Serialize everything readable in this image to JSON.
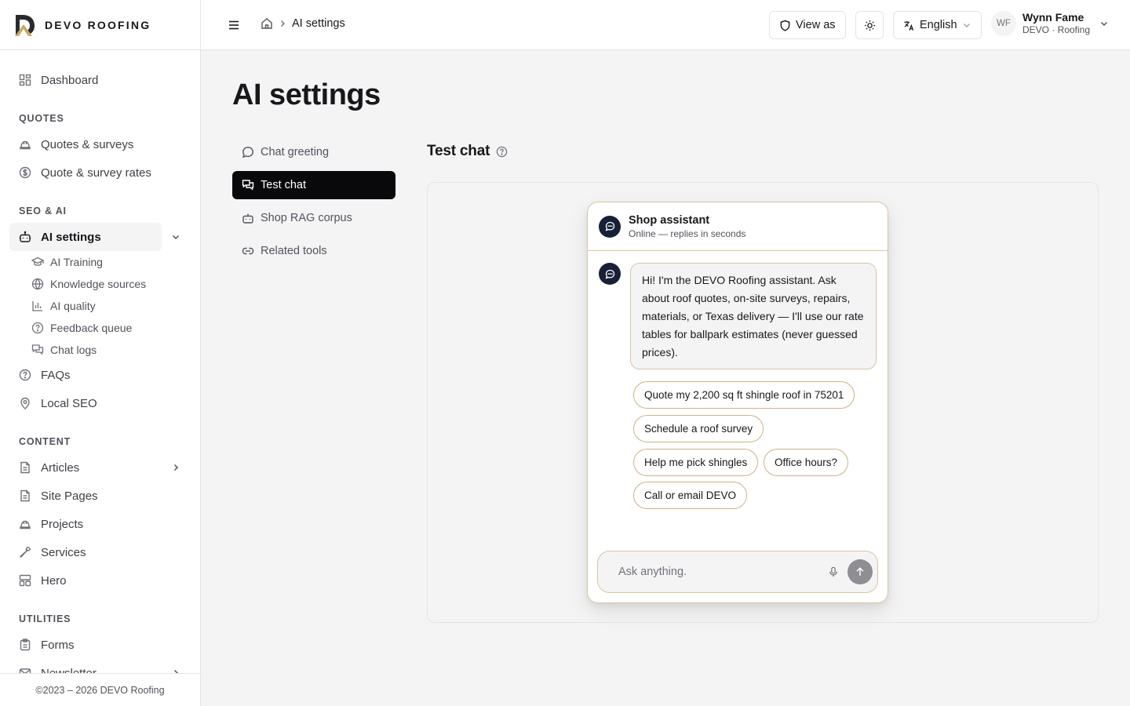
{
  "brand": {
    "name": "DEVO ROOFING"
  },
  "sidebar": {
    "dashboard": "Dashboard",
    "sections": {
      "quotes": "QUOTES",
      "seo_ai": "SEO & AI",
      "content": "CONTENT",
      "utilities": "UTILITIES"
    },
    "quotes_items": [
      "Quotes & surveys",
      "Quote & survey rates"
    ],
    "ai_settings": "AI settings",
    "ai_sub_items": [
      "AI Training",
      "Knowledge sources",
      "AI quality",
      "Feedback queue",
      "Chat logs"
    ],
    "faqs": "FAQs",
    "local_seo": "Local SEO",
    "content_items": [
      "Articles",
      "Site Pages",
      "Projects",
      "Services",
      "Hero"
    ],
    "utilities_items": [
      "Forms",
      "Newsletter"
    ],
    "footer": "©2023 – 2026 DEVO Roofing"
  },
  "topbar": {
    "breadcrumb_current": "AI settings",
    "view_as": "View as",
    "language": "English",
    "user": {
      "initials": "WF",
      "name": "Wynn Fame",
      "org": "DEVO · Roofing"
    }
  },
  "main": {
    "title": "AI settings",
    "subnav": [
      "Chat greeting",
      "Test chat",
      "Shop RAG corpus",
      "Related tools"
    ],
    "active_subnav": "Test chat",
    "section_heading": "Test chat"
  },
  "chat": {
    "title": "Shop assistant",
    "status": "Online — replies in seconds",
    "greeting": "Hi! I'm the DEVO Roofing assistant. Ask about roof quotes, on-site surveys, repairs, materials, or Texas delivery — I'll use our rate tables for ballpark estimates (never guessed prices).",
    "suggestions": [
      "Quote my 2,200 sq ft shingle roof in 75201",
      "Schedule a roof survey",
      "Help me pick shingles",
      "Office hours?",
      "Call or email DEVO"
    ],
    "input_placeholder": "Ask anything."
  },
  "colors": {
    "accent_dark": "#09090b",
    "bot_avatar": "#172036",
    "chat_border": "#d6c6a7",
    "send_button": "#8e8e93"
  }
}
